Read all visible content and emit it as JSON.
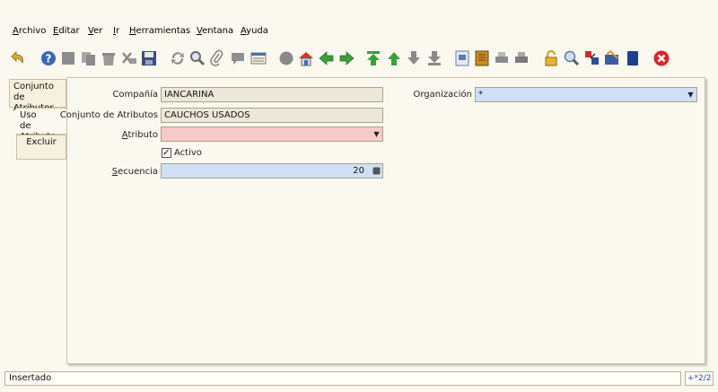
{
  "menu": [
    "Archivo",
    "Editar",
    "Ver",
    "Ir",
    "Herramientas",
    "Ventana",
    "Ayuda"
  ],
  "toolbar": [
    "undo-icon",
    "help-icon",
    "new-icon",
    "copy-icon",
    "delete-icon",
    "delete-selection-icon",
    "save-icon",
    "refresh-icon",
    "find-icon",
    "attachment-icon",
    "chat-icon",
    "grid-toggle-icon",
    "history-icon",
    "home-icon",
    "previous-icon",
    "next-icon",
    "first-record-icon",
    "previous-record-icon",
    "next-record-icon",
    "last-record-icon",
    "report-icon",
    "archive-icon",
    "print-preview-icon",
    "print-icon",
    "lock-icon",
    "zoom-across-icon",
    "request-icon",
    "product-info-icon",
    "workflow-icon",
    "close-window-icon"
  ],
  "tabs": [
    {
      "label": "Conjunto\nde Atributos"
    },
    {
      "label": "Uso\nde Atributo"
    },
    {
      "label": "Excluir"
    }
  ],
  "form": {
    "company_label": "Compañía",
    "company_value": "IANCARINA",
    "attribute_set_label": "Conjunto de Atributos",
    "attribute_set_value": "CAUCHOS USADOS",
    "attribute_label": "Atributo",
    "attribute_value": "",
    "active_label": "Activo",
    "sequence_label": "Secuencia",
    "sequence_value": "20",
    "org_label": "Organización",
    "org_value": "*"
  },
  "status": {
    "message": "Insertado",
    "record": "+*2/2"
  },
  "colors": {
    "required": "#f7c9c9",
    "editable": "#cfe0f6",
    "readonly": "#ece8d9",
    "background": "#fbf8ef"
  }
}
